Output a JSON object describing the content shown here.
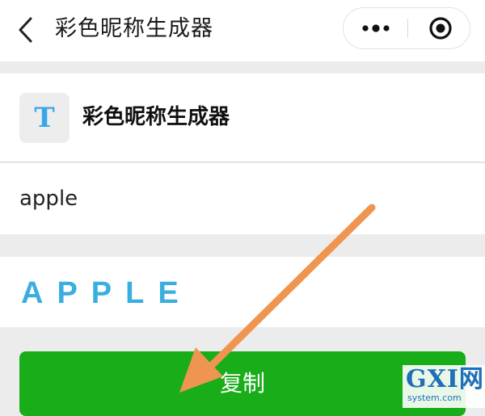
{
  "nav": {
    "title": "彩色昵称生成器"
  },
  "header": {
    "app_icon_letter": "T",
    "app_name": "彩色昵称生成器"
  },
  "input": {
    "value": "apple"
  },
  "result": {
    "text": "APPLE"
  },
  "actions": {
    "copy_label": "复制"
  },
  "watermark": {
    "logo": "GXI网",
    "site": "system.com"
  },
  "colors": {
    "accent_green": "#19ad19",
    "result_blue": "#3aaee0",
    "arrow_orange": "#ef9550"
  }
}
